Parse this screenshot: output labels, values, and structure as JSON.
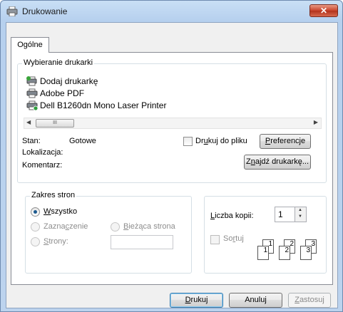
{
  "window": {
    "title": "Drukowanie",
    "close_label": "✕"
  },
  "tabs": [
    {
      "label": "Ogólne"
    }
  ],
  "printer_group": {
    "legend": "Wybieranie drukarki",
    "printers": [
      {
        "name": "Dodaj drukarkę",
        "icon": "add-printer-icon"
      },
      {
        "name": "Adobe PDF",
        "icon": "printer-icon"
      },
      {
        "name": "Dell B1260dn Mono Laser Printer",
        "icon": "default-printer-icon"
      }
    ],
    "scroll_thumb": "III",
    "status_label": "Stan:",
    "status_value": "Gotowe",
    "location_label": "Lokalizacja:",
    "location_value": "",
    "comment_label": "Komentarz:",
    "comment_value": "",
    "print_to_file": {
      "label_pre": "Dr",
      "label_u": "u",
      "label_post": "kuj do pliku",
      "checked": false
    },
    "preferences_label": {
      "pre": "",
      "u": "P",
      "post": "referencje"
    },
    "find_printer_label": {
      "pre": "Z",
      "u": "n",
      "post": "ajdź drukarkę..."
    }
  },
  "range_group": {
    "legend": "Zakres stron",
    "all": {
      "pre": "",
      "u": "W",
      "post": "szystko",
      "checked": true
    },
    "selection": {
      "pre": "Zazna",
      "u": "c",
      "post": "zenie",
      "enabled": false
    },
    "current": {
      "pre": "",
      "u": "B",
      "post": "ieżąca strona",
      "enabled": false
    },
    "pages": {
      "pre": "",
      "u": "S",
      "post": "trony:",
      "enabled": false,
      "value": ""
    }
  },
  "copies_group": {
    "copies_label": {
      "pre": "",
      "u": "L",
      "post": "iczba kopii:"
    },
    "copies_value": "1",
    "collate": {
      "pre": "So",
      "u": "r",
      "post": "tuj",
      "enabled": false
    },
    "collate_pages": [
      "1",
      "1",
      "2",
      "2",
      "3",
      "3"
    ]
  },
  "buttons": {
    "print": {
      "pre": "",
      "u": "D",
      "post": "rukuj"
    },
    "cancel": "Anuluj",
    "apply": {
      "pre": "",
      "u": "Z",
      "post": "astosuj"
    }
  }
}
